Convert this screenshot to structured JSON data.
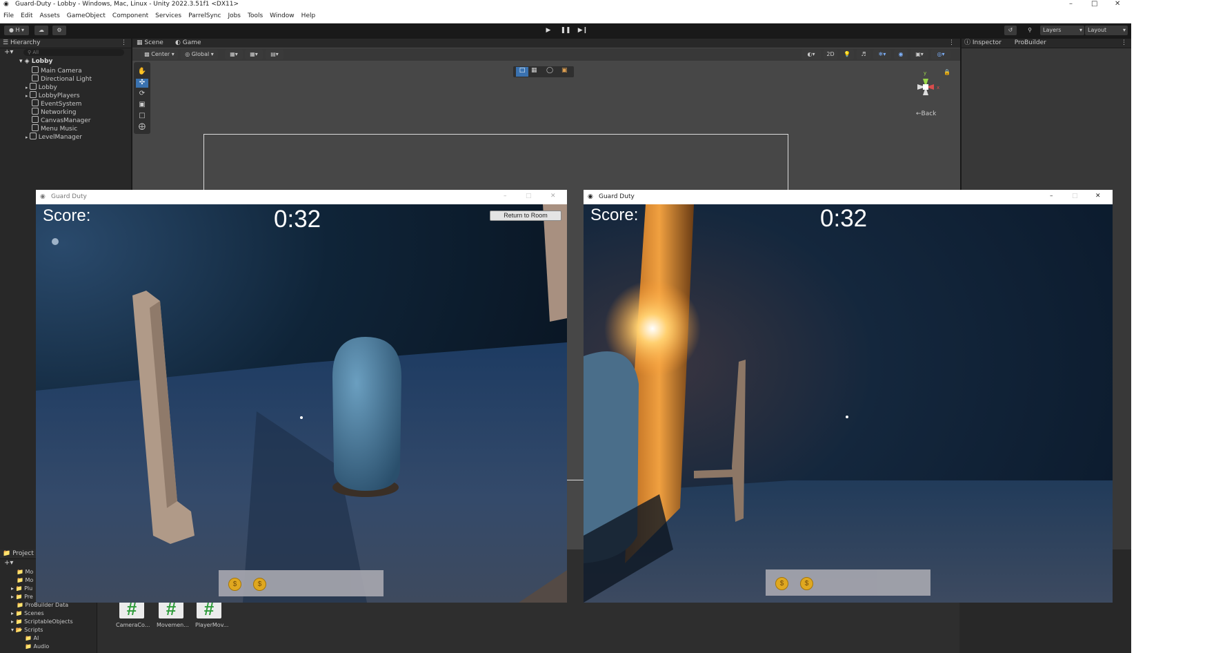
{
  "window": {
    "title": "Guard-Duty - Lobby - Windows, Mac, Linux - Unity 2022.3.51f1 <DX11>"
  },
  "menu": [
    "File",
    "Edit",
    "Assets",
    "GameObject",
    "Component",
    "Services",
    "ParrelSync",
    "Jobs",
    "Tools",
    "Window",
    "Help"
  ],
  "toolbar": {
    "account": "H",
    "layers_label": "Layers",
    "layout_label": "Layout"
  },
  "hierarchy": {
    "tab": "Hierarchy",
    "search_placeholder": "All",
    "scene": "Lobby",
    "items": [
      "Main Camera",
      "Directional Light",
      "Lobby",
      "LobbyPlayers",
      "EventSystem",
      "Networking",
      "CanvasManager",
      "Menu Music",
      "LevelManager"
    ]
  },
  "scene_view": {
    "tabs": [
      "Scene",
      "Game"
    ],
    "pivot": "Center",
    "space": "Global",
    "mode_2d": "2D",
    "gizmo_label": "←Back",
    "gizmo_x": "x",
    "gizmo_y": "y"
  },
  "inspector": {
    "tabs": [
      "Inspector",
      "ProBuilder"
    ]
  },
  "project": {
    "tab": "Project",
    "folders": [
      "Mo",
      "Mo",
      "Plu",
      "Pre",
      "ProBuilder Data",
      "Scenes",
      "ScriptableObjects",
      "Scripts",
      "AI",
      "Audio"
    ],
    "assets": [
      "CameraCo...",
      "Movemen...",
      "PlayerMov..."
    ],
    "asset_icon": "#"
  },
  "game_windows": [
    {
      "title": "Guard Duty",
      "score_label": "Score:",
      "timer": "0:32",
      "button": "Return to Room",
      "coins": 2
    },
    {
      "title": "Guard Duty",
      "score_label": "Score:",
      "timer": "0:32",
      "coins": 2
    }
  ],
  "coin_symbol": "$",
  "colors": {
    "editor_bg": "#191919",
    "panel_bg": "#282828",
    "scene_bg": "#474747",
    "accent": "#3a72b0",
    "coin": "#f2b31a"
  }
}
